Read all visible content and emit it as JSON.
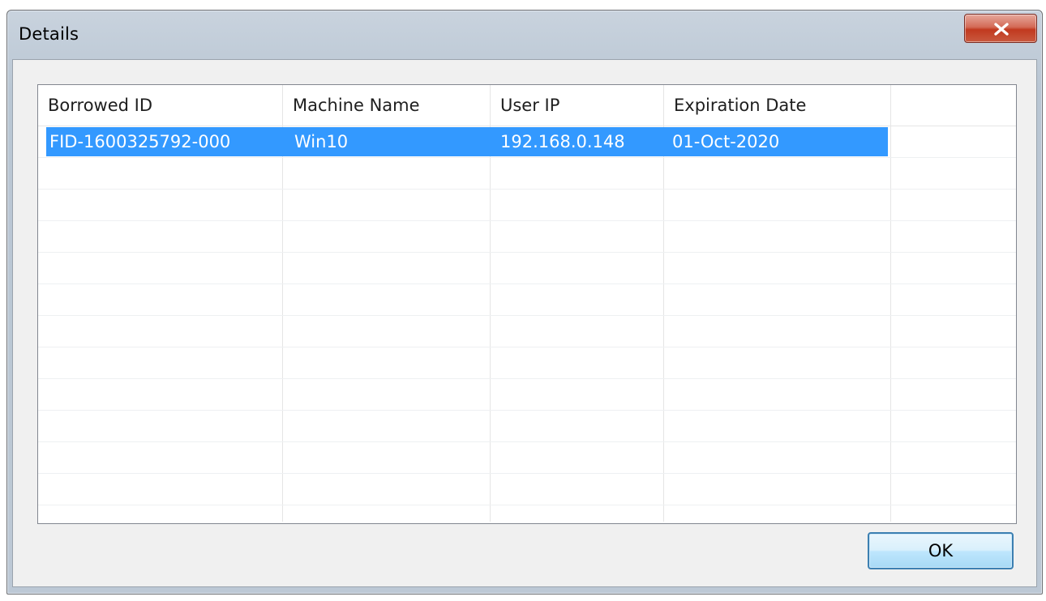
{
  "window": {
    "title": "Details",
    "close_icon": "close-icon"
  },
  "table": {
    "columns": [
      "Borrowed ID",
      "Machine Name",
      "User IP",
      "Expiration Date"
    ],
    "rows": [
      {
        "selected": true,
        "cells": [
          "FID-1600325792-000",
          "Win10",
          "192.168.0.148",
          "01-Oct-2020"
        ]
      }
    ]
  },
  "buttons": {
    "ok_label": "OK"
  },
  "colors": {
    "selection": "#3399ff",
    "close_button": "#c1391f",
    "ok_border": "#3c7fb1"
  }
}
